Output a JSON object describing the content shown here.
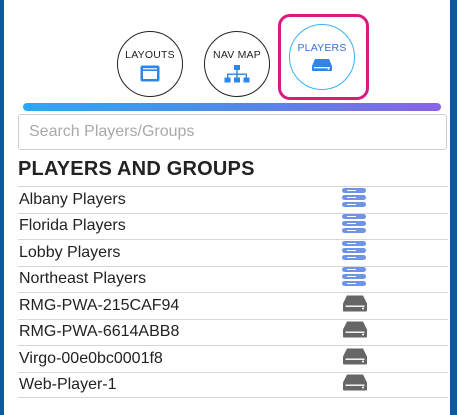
{
  "tabs": [
    {
      "label": "LAYOUTS",
      "icon": "layout-window-icon"
    },
    {
      "label": "NAV MAP",
      "icon": "sitemap-icon"
    },
    {
      "label": "PLAYERS",
      "icon": "player-device-icon",
      "active": true
    }
  ],
  "search": {
    "placeholder": "Search Players/Groups",
    "value": ""
  },
  "section_title": "PLAYERS AND GROUPS",
  "items": [
    {
      "name": "Albany Players",
      "type": "group",
      "icon": "player-group-icon"
    },
    {
      "name": "Florida Players",
      "type": "group",
      "icon": "player-group-icon"
    },
    {
      "name": "Lobby Players",
      "type": "group",
      "icon": "player-group-icon"
    },
    {
      "name": "Northeast Players",
      "type": "group",
      "icon": "player-group-icon"
    },
    {
      "name": "RMG-PWA-215CAF94",
      "type": "player",
      "icon": "player-device-icon"
    },
    {
      "name": "RMG-PWA-6614ABB8",
      "type": "player",
      "icon": "player-device-icon"
    },
    {
      "name": "Virgo-00e0bc0001f8",
      "type": "player",
      "icon": "player-device-icon"
    },
    {
      "name": "Web-Player-1",
      "type": "player",
      "icon": "player-device-icon"
    }
  ],
  "colors": {
    "frame": "#0f56a3",
    "active_outline": "#d81b83",
    "active_ring": "#3bb3f0",
    "icon_blue": "#2e86e8",
    "group_icon": "#6f93e6",
    "player_icon": "#666666"
  }
}
